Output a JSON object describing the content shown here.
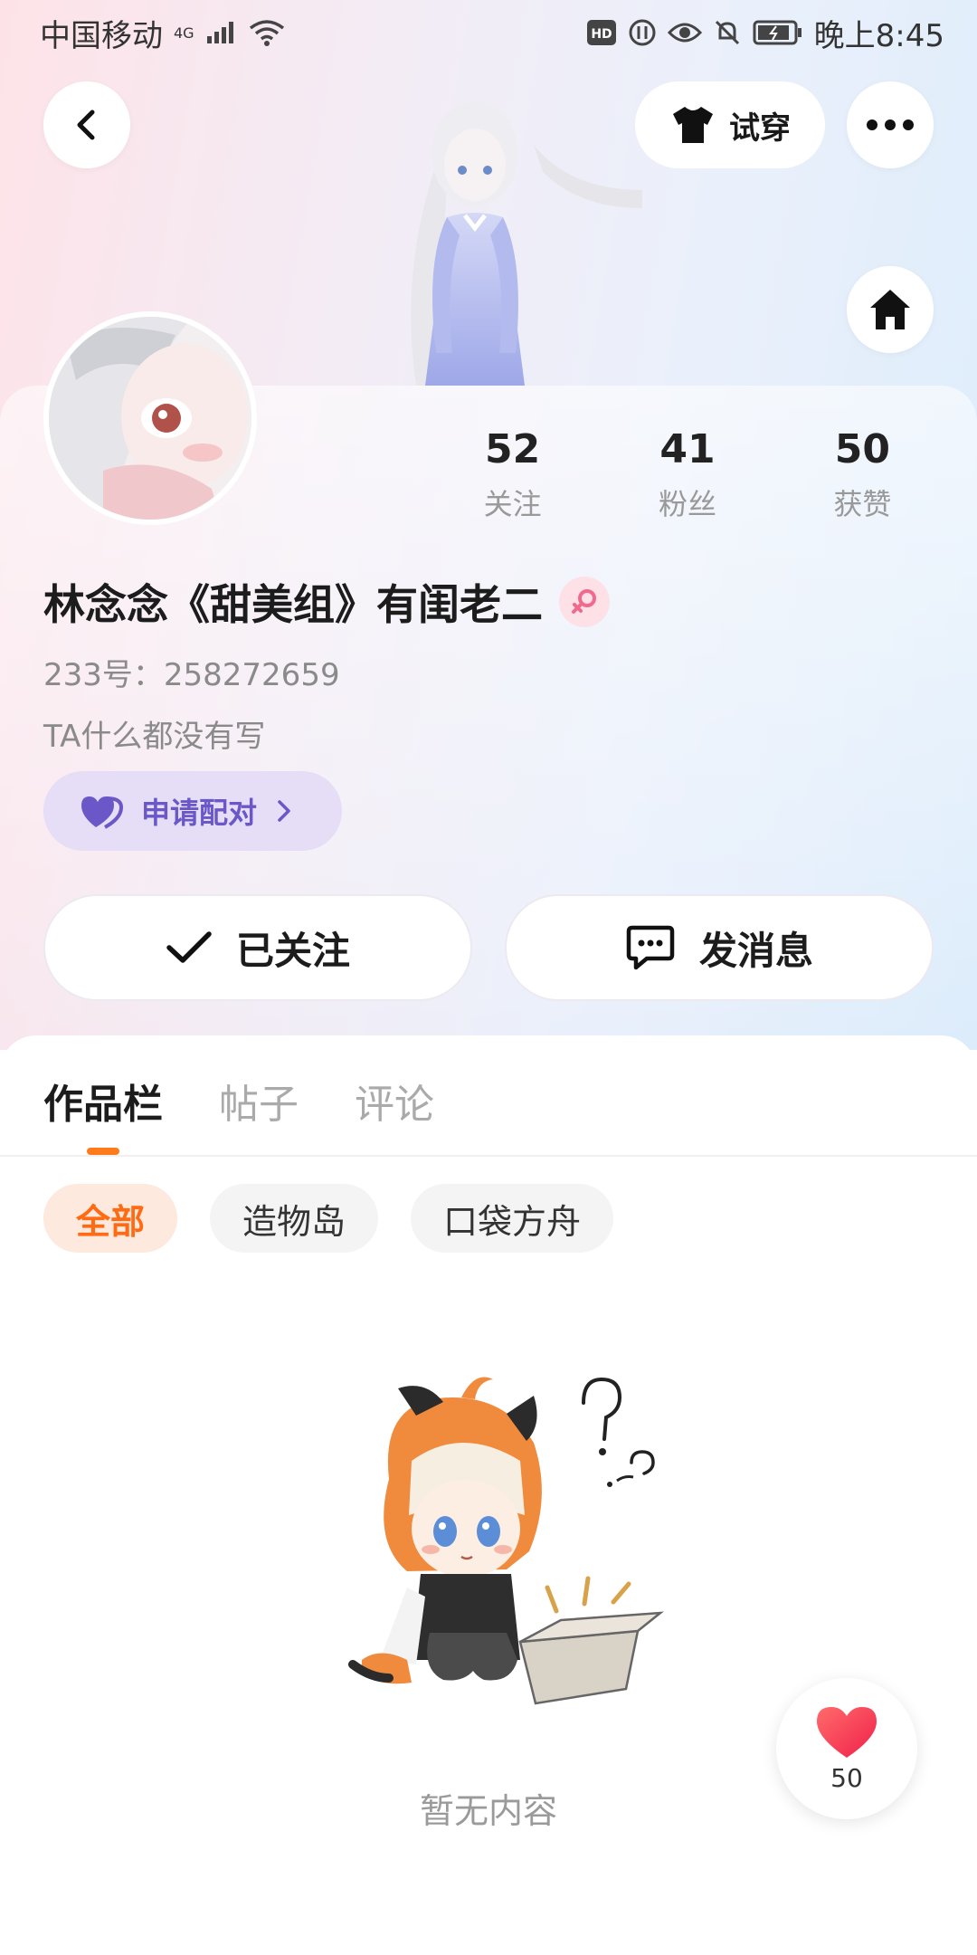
{
  "status_bar": {
    "carrier": "中国移动",
    "network": "4G",
    "time": "晚上8:45",
    "icons": [
      "signal-icon",
      "wifi-icon",
      "hd-icon",
      "data-icon",
      "eye-icon",
      "mute-icon",
      "battery-icon"
    ]
  },
  "header": {
    "back_icon": "chevron-left-icon",
    "try_on_label": "试穿",
    "more_icon": "more-icon",
    "home_icon": "home-icon"
  },
  "profile": {
    "stats": [
      {
        "value": "52",
        "label": "关注"
      },
      {
        "value": "41",
        "label": "粉丝"
      },
      {
        "value": "50",
        "label": "获赞"
      }
    ],
    "name": "林念念《甜美组》有闺老二",
    "gender": "female",
    "uid": "233号：258272659",
    "bio": "TA什么都没有写",
    "pair_label": "申请配对",
    "follow_label": "已关注",
    "message_label": "发消息"
  },
  "content": {
    "tabs": [
      {
        "label": "作品栏",
        "active": true
      },
      {
        "label": "帖子",
        "active": false
      },
      {
        "label": "评论",
        "active": false
      }
    ],
    "chips": [
      {
        "label": "全部",
        "active": true
      },
      {
        "label": "造物岛",
        "active": false
      },
      {
        "label": "口袋方舟",
        "active": false
      }
    ],
    "empty_text": "暂无内容"
  },
  "like_fab": {
    "count": "50"
  },
  "colors": {
    "accent": "#ff7a1a",
    "pair_purple": "#6b57c8",
    "heart_red": "#ff3b4a"
  }
}
